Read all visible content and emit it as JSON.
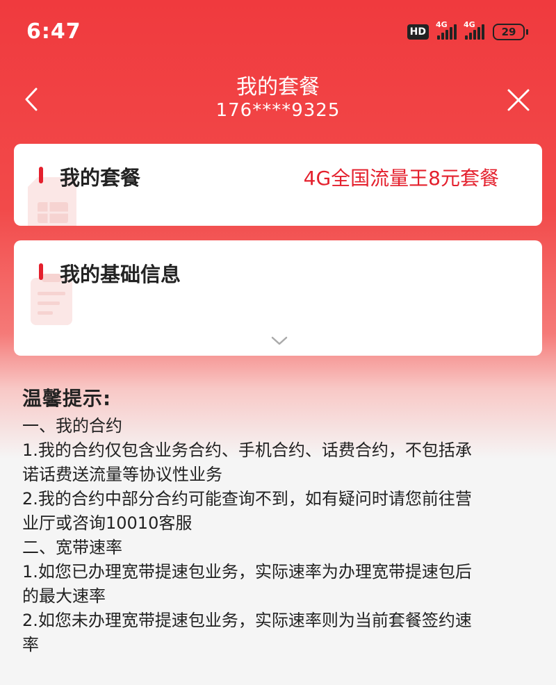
{
  "status_bar": {
    "time": "6:47",
    "hd_badge": "HD",
    "sim1_network": "4G",
    "sim2_network": "4G",
    "battery_level": "29"
  },
  "header": {
    "title": "我的套餐",
    "phone_number": "176****9325"
  },
  "plan_card": {
    "title": "我的套餐",
    "value": "4G全国流量王8元套餐"
  },
  "info_card": {
    "title": "我的基础信息"
  },
  "tips": {
    "title": "温馨提示:",
    "lines": [
      "一、我的合约",
      "1.我的合约仅包含业务合约、手机合约、话费合约，不包括承",
      "诺话费送流量等协议性业务",
      "2.我的合约中部分合约可能查询不到，如有疑问时请您前往营",
      "业厅或咨询10010客服",
      "二、宽带速率",
      "1.如您已办理宽带提速包业务，实际速率为办理宽带提速包后",
      "的最大速率",
      "2.如您未办理宽带提速包业务，实际速率则为当前套餐签约速",
      "率"
    ]
  },
  "colors": {
    "accent": "#e4202d",
    "header_bg": "#f03a3e"
  },
  "icons": {
    "back": "chevron-left-icon",
    "close": "close-icon",
    "expand": "chevron-down-icon"
  }
}
